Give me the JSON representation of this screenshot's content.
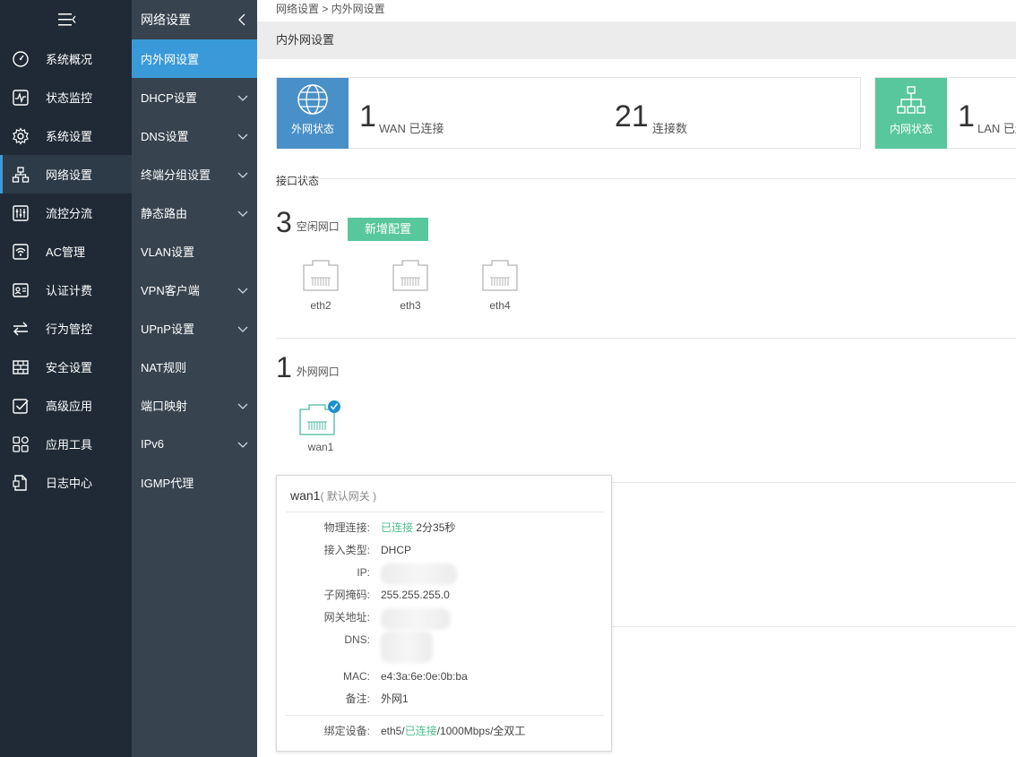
{
  "sidebar": {
    "items": [
      {
        "label": "系统概况",
        "icon": "dashboard-icon"
      },
      {
        "label": "状态监控",
        "icon": "monitor-icon"
      },
      {
        "label": "系统设置",
        "icon": "gear-icon"
      },
      {
        "label": "网络设置",
        "icon": "network-icon"
      },
      {
        "label": "流控分流",
        "icon": "sliders-icon"
      },
      {
        "label": "AC管理",
        "icon": "wifi-icon"
      },
      {
        "label": "认证计费",
        "icon": "id-card-icon"
      },
      {
        "label": "行为管控",
        "icon": "arrows-swap-icon"
      },
      {
        "label": "安全设置",
        "icon": "firewall-icon"
      },
      {
        "label": "高级应用",
        "icon": "checkbox-icon"
      },
      {
        "label": "应用工具",
        "icon": "apps-icon"
      },
      {
        "label": "日志中心",
        "icon": "document-icon"
      }
    ],
    "active_index": 3
  },
  "subnav": {
    "title": "网络设置",
    "items": [
      {
        "label": "内外网设置",
        "has_children": false
      },
      {
        "label": "DHCP设置",
        "has_children": true
      },
      {
        "label": "DNS设置",
        "has_children": true
      },
      {
        "label": "终端分组设置",
        "has_children": true
      },
      {
        "label": "静态路由",
        "has_children": true
      },
      {
        "label": "VLAN设置",
        "has_children": false
      },
      {
        "label": "VPN客户端",
        "has_children": true
      },
      {
        "label": "UPnP设置",
        "has_children": true
      },
      {
        "label": "NAT规则",
        "has_children": false
      },
      {
        "label": "端口映射",
        "has_children": true
      },
      {
        "label": "IPv6",
        "has_children": true
      },
      {
        "label": "IGMP代理",
        "has_children": false
      }
    ],
    "active_index": 0
  },
  "main": {
    "breadcrumb": "网络设置 > 内外网设置",
    "page_title": "内外网设置",
    "wan_card": {
      "badge_label": "外网状态",
      "badge_color": "#4a90c8",
      "wan_count": "1",
      "wan_label": "WAN 已连接",
      "conn_count": "21",
      "conn_label": "连接数"
    },
    "lan_card": {
      "badge_label": "内网状态",
      "badge_color": "#58c79d",
      "lan_count": "1",
      "lan_label": "LAN 已连"
    },
    "interface_status_label": "接口状态",
    "idle": {
      "count": "3",
      "label": "空闲网口",
      "add_button": "新增配置",
      "ports": [
        "eth2",
        "eth3",
        "eth4"
      ]
    },
    "wan": {
      "count": "1",
      "label": "外网网口",
      "ports": [
        "wan1"
      ]
    }
  },
  "popup": {
    "title": "wan1",
    "subtitle": "( 默认网关 )",
    "rows": {
      "physical_label": "物理连接:",
      "physical_status": "已连接",
      "physical_time": "2分35秒",
      "type_label": "接入类型:",
      "type_value": "DHCP",
      "ip_label": "IP:",
      "mask_label": "子网掩码:",
      "mask_value": "255.255.255.0",
      "gateway_label": "网关地址:",
      "dns_label": "DNS:",
      "mac_label": "MAC:",
      "mac_value": "e4:3a:6e:0e:0b:ba",
      "note_label": "备注:",
      "note_value": "外网1",
      "bind_label": "绑定设备:",
      "bind_prefix": "eth5/",
      "bind_status": "已连接",
      "bind_suffix": "/1000Mbps/全双工"
    }
  }
}
